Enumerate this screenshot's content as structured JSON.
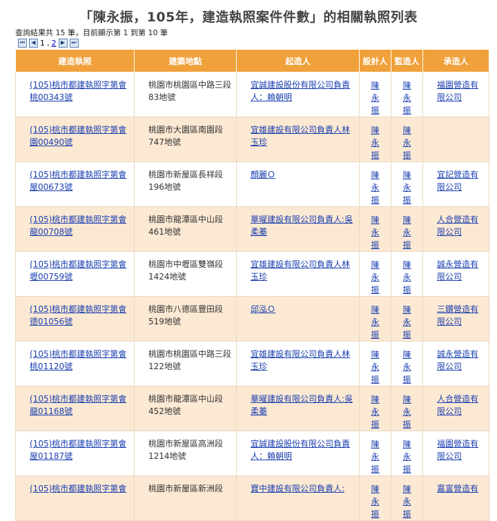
{
  "title": "「陳永振，105年，建造執照案件件數」的相關執照列表",
  "summary": "查詢結果共 15 筆，目前顯示第 1 到第 10 筆",
  "pager": {
    "current": "1",
    "separator": ",",
    "other": "2"
  },
  "columns": [
    "建造執照",
    "建築地點",
    "起造人",
    "設計人",
    "監造人",
    "承造人"
  ],
  "rows": [
    {
      "permit": "(105)桃市都建執照字第會桃00343號",
      "address": "桃園市桃園區中路三段83地號",
      "owner": "宜誠建設股份有限公司負責人：賴朝明",
      "designer": "陳永振",
      "supervisor": "陳永振",
      "contractor": "福園營造有限公司"
    },
    {
      "permit": "(105)桃市都建執照字第會園00490號",
      "address": "桃園市大園區南園段747地號",
      "owner": "宜雄建設有限公司負責人林玉珍",
      "designer": "陳永振",
      "supervisor": "陳永振",
      "contractor": ""
    },
    {
      "permit": "(105)桃市都建執照字第會屋00673號",
      "address": "桃園市新屋區長祥段196地號",
      "owner": "顏麗Ｏ",
      "designer": "陳永振",
      "supervisor": "陳永振",
      "contractor": "宜記營造有限公司"
    },
    {
      "permit": "(105)桃市都建執照字第會龍00708號",
      "address": "桃園市龍潭區中山段461地號",
      "owner": "華曜建設有限公司負責人:吳柔蓁",
      "designer": "陳永振",
      "supervisor": "陳永振",
      "contractor": "人合營造有限公司"
    },
    {
      "permit": "(105)桃市都建執照字第會壢00759號",
      "address": "桃園市中壢區雙嶺段1424地號",
      "owner": "宜雄建設有限公司負責人林玉珍",
      "designer": "陳永振",
      "supervisor": "陳永振",
      "contractor": "誠永營造有限公司"
    },
    {
      "permit": "(105)桃市都建執照字第會德01056號",
      "address": "桃園市八德區豐田段519地號",
      "owner": "邱泓Ｏ",
      "designer": "陳永振",
      "supervisor": "陳永振",
      "contractor": "三鑽營造有限公司"
    },
    {
      "permit": "(105)桃市都建執照字第會桃01120號",
      "address": "桃園市桃園區中路三段122地號",
      "owner": "宜雄建設有限公司負責人林玉珍",
      "designer": "陳永振",
      "supervisor": "陳永振",
      "contractor": "誠永營造有限公司"
    },
    {
      "permit": "(105)桃市都建執照字第會龍01168號",
      "address": "桃園市龍潭區中山段452地號",
      "owner": "華曜建設有限公司負責人:吳柔蓁",
      "designer": "陳永振",
      "supervisor": "陳永振",
      "contractor": "人合營造有限公司"
    },
    {
      "permit": "(105)桃市都建執照字第會屋01187號",
      "address": "桃園市新屋區高洲段1214地號",
      "owner": "宜誠建設股份有限公司負責人：賴朝明",
      "designer": "陳永振",
      "supervisor": "陳永振",
      "contractor": "福園營造有限公司"
    },
    {
      "permit": "(105)桃市都建執照字第會",
      "address": "桃園市新屋區新洲段",
      "owner": "寶中建設有限公司負責人:",
      "designer": "陳永振",
      "supervisor": "陳永振",
      "contractor": "嘉富營造有"
    }
  ]
}
